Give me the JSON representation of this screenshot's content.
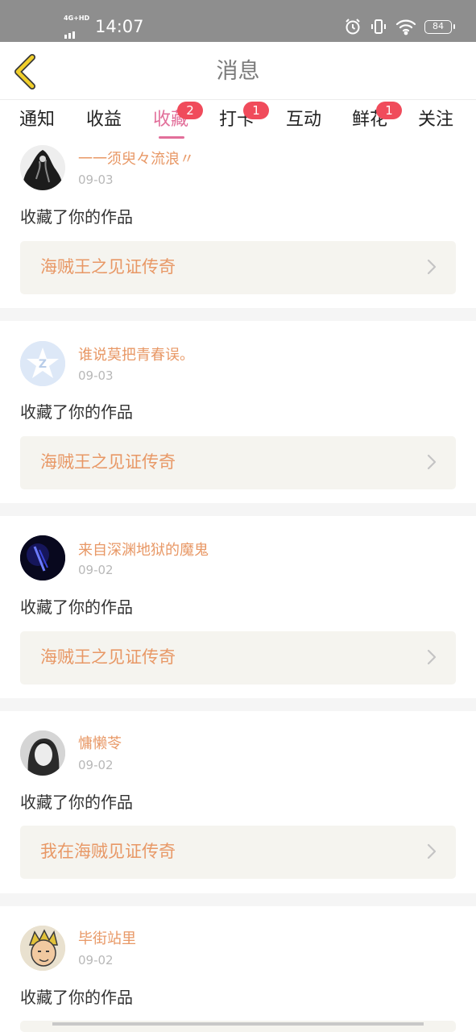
{
  "status_bar": {
    "network": "4G+HD",
    "time": "14:07",
    "battery": "84",
    "icons": [
      "alarm-icon",
      "vibrate-icon",
      "wifi-icon",
      "battery-icon"
    ]
  },
  "header": {
    "title": "消息",
    "back_icon": "chevron-left-icon"
  },
  "tabs": [
    {
      "label": "通知"
    },
    {
      "label": "收益"
    },
    {
      "label": "收藏",
      "badge": "2",
      "active": true
    },
    {
      "label": "打卡",
      "badge": "1"
    },
    {
      "label": "互动"
    },
    {
      "label": "鲜花",
      "badge": "1"
    },
    {
      "label": "关注"
    }
  ],
  "items": [
    {
      "username": "一一须臾々流浪〃",
      "date": "09-03",
      "action": "收藏了你的作品",
      "work_title": "海贼王之见证传奇"
    },
    {
      "username": "谁说莫把青春误。",
      "date": "09-03",
      "action": "收藏了你的作品",
      "work_title": "海贼王之见证传奇"
    },
    {
      "username": "来自深渊地狱的魔鬼",
      "date": "09-02",
      "action": "收藏了你的作品",
      "work_title": "海贼王之见证传奇"
    },
    {
      "username": "慵懒苓",
      "date": "09-02",
      "action": "收藏了你的作品",
      "work_title": "我在海贼见证传奇"
    },
    {
      "username": "毕街站里",
      "date": "09-02",
      "action": "收藏了你的作品"
    }
  ],
  "colors": {
    "accent_pink": "#e26f9a",
    "username_orange": "#e89866",
    "badge_red": "#f04b5b",
    "back_icon_yellow": "#f1cf2a",
    "status_bar_gray": "#8e8e8e"
  }
}
